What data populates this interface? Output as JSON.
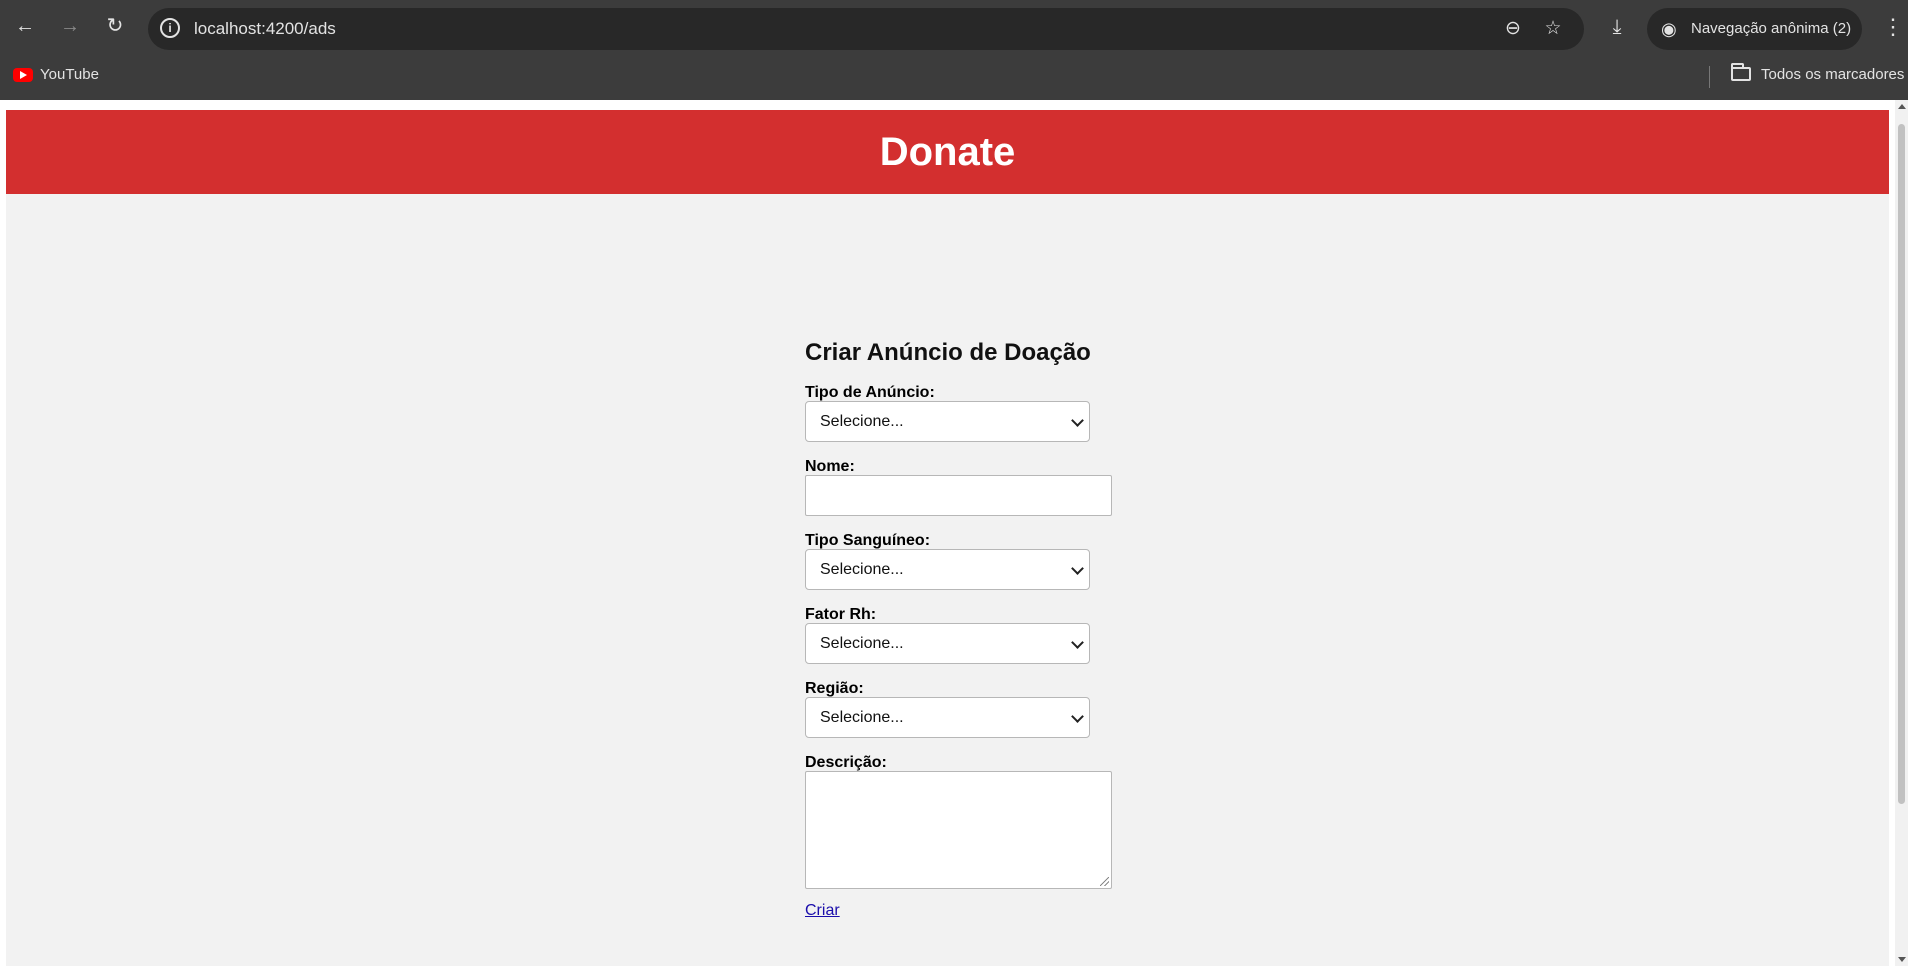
{
  "browser": {
    "url": "localhost:4200/ads",
    "incognito_label": "Navegação anônima (2)",
    "bookmarks": [
      {
        "label": "YouTube",
        "icon": "youtube-icon"
      }
    ],
    "all_bookmarks_label": "Todos os marcadores"
  },
  "page": {
    "header_title": "Donate",
    "form": {
      "title": "Criar Anúncio de Doação",
      "fields": {
        "ad_type": {
          "label": "Tipo de Anúncio:",
          "value": "Selecione..."
        },
        "name": {
          "label": "Nome:",
          "value": ""
        },
        "blood_type": {
          "label": "Tipo Sanguíneo:",
          "value": "Selecione..."
        },
        "rh_factor": {
          "label": "Fator Rh:",
          "value": "Selecione..."
        },
        "region": {
          "label": "Região:",
          "value": "Selecione..."
        },
        "description": {
          "label": "Descrição:",
          "value": ""
        }
      },
      "submit_label": "Criar"
    }
  },
  "colors": {
    "header_bg": "#d32f2f",
    "page_bg": "#f2f2f2",
    "link": "#1a0dab"
  }
}
